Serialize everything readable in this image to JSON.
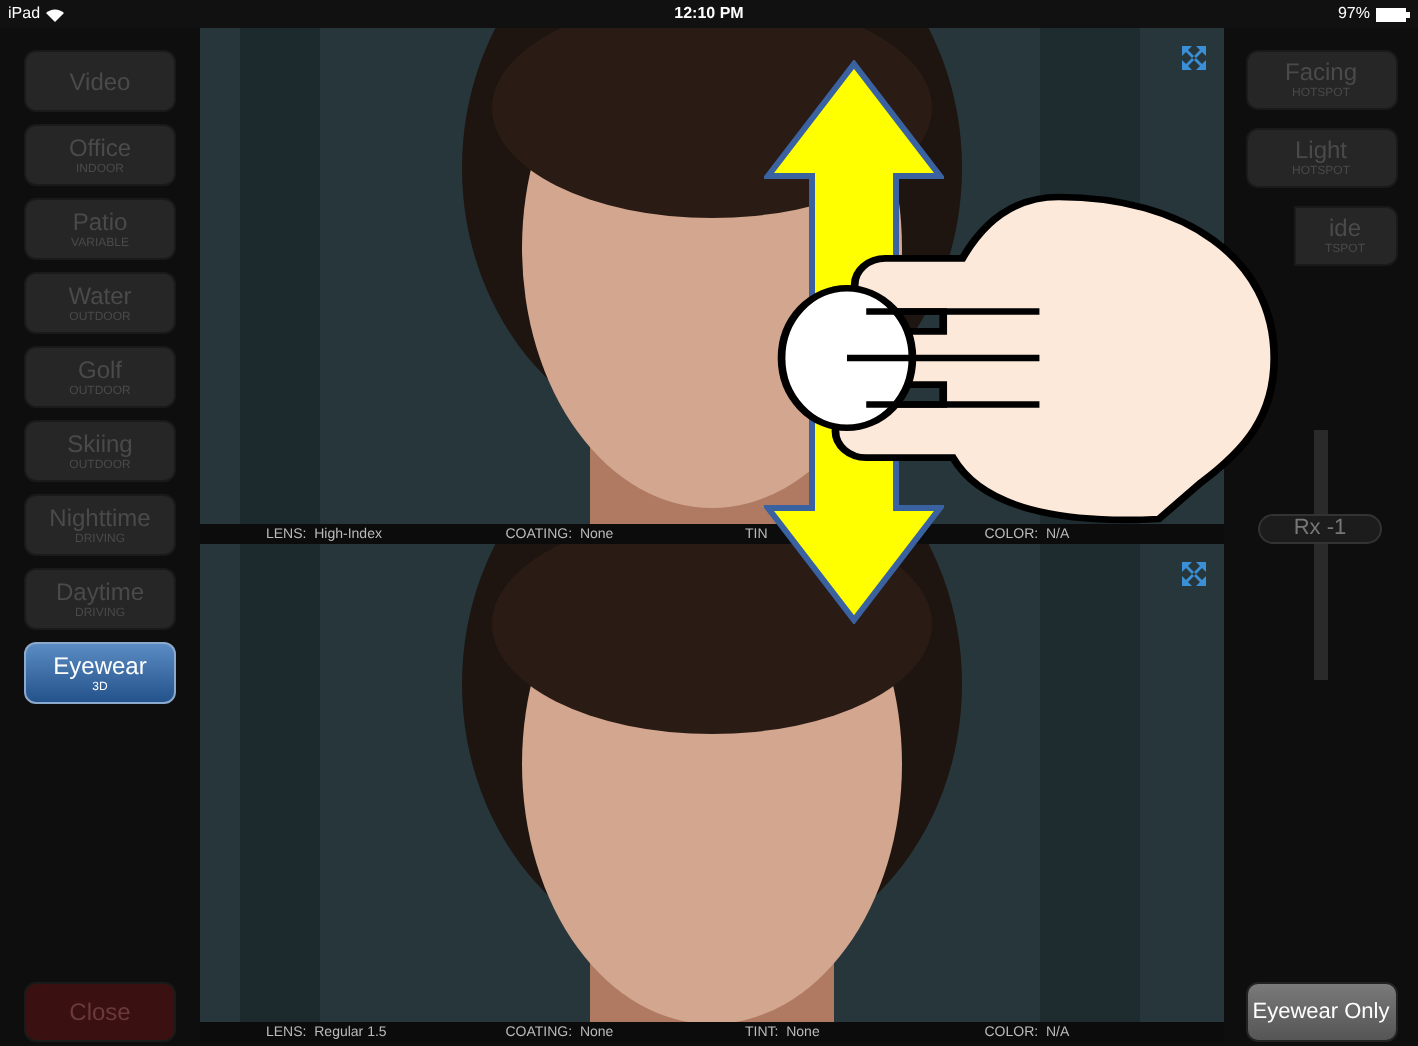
{
  "status_bar": {
    "device": "iPad",
    "time": "12:10 PM",
    "battery": "97%"
  },
  "scenes": [
    {
      "label": "Video",
      "selected": false
    },
    {
      "label": "Office",
      "sublabel": "INDOOR",
      "selected": false
    },
    {
      "label": "Patio",
      "sublabel": "VARIABLE",
      "selected": false
    },
    {
      "label": "Water",
      "sublabel": "OUTDOOR",
      "selected": false
    },
    {
      "label": "Golf",
      "sublabel": "OUTDOOR",
      "selected": false
    },
    {
      "label": "Skiing",
      "sublabel": "OUTDOOR",
      "selected": false
    },
    {
      "label": "Nighttime",
      "sublabel": "DRIVING",
      "selected": false
    },
    {
      "label": "Daytime",
      "sublabel": "DRIVING",
      "selected": false
    },
    {
      "label": "Eyewear",
      "sublabel": "3D",
      "selected": true
    }
  ],
  "close_button": "Close",
  "views": [
    {
      "kind": "picture",
      "info": [
        "LENS:  High-Index",
        "COATING:  None",
        "TIN",
        "COLOR:  N/A"
      ]
    },
    {
      "kind": "picture",
      "info": [
        "LENS:  Regular 1.5",
        "COATING:  None",
        "TINT:  None",
        "COLOR:  N/A"
      ]
    }
  ],
  "hotspots": [
    {
      "kind": "full",
      "label": "Facing",
      "sublabel": "HOTSPOT"
    },
    {
      "kind": "full",
      "label": "Light",
      "sublabel": "HOTSPOT"
    },
    {
      "kind": "partial",
      "label": "ide",
      "sublabel": "TSPOT"
    }
  ],
  "rx_slider": {
    "label": "Rx -1",
    "level": 0.6
  },
  "eyewear_only_button": "Eyewear Only"
}
